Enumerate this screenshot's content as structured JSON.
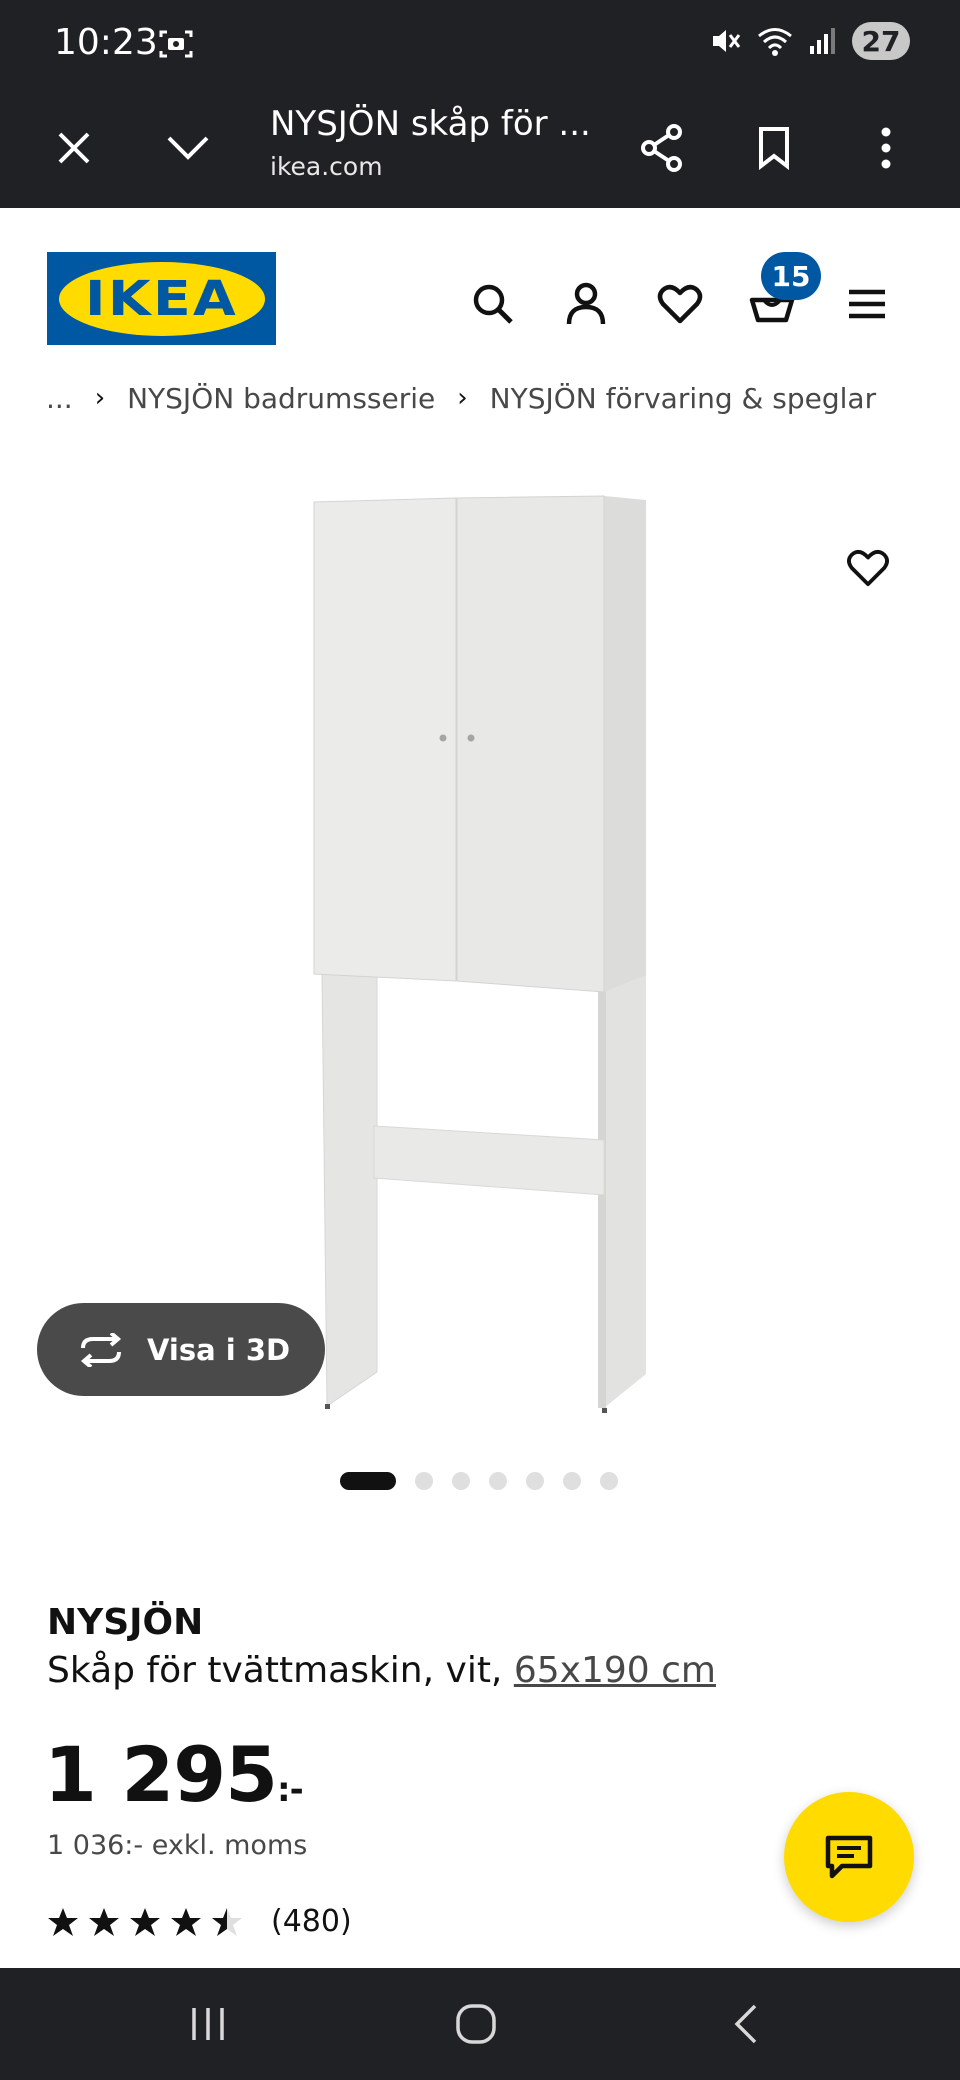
{
  "status_bar": {
    "time": "10:23",
    "battery": "27"
  },
  "browser": {
    "page_title": "NYSJÖN skåp för ...",
    "url": "ikea.com"
  },
  "header": {
    "logo_text": "IKEA",
    "cart_count": "15"
  },
  "breadcrumb": {
    "items": [
      "...",
      "NYSJÖN badrumsserie",
      "NYSJÖN förvaring & speglar"
    ]
  },
  "product": {
    "view_3d_label": "Visa i 3D",
    "name": "NYSJÖN",
    "description": "Skåp för tvättmaskin, vit, ",
    "size": "65x190 cm",
    "price": "1 295",
    "price_suffix": ":-",
    "price_excl_vat": "1 036:- exkl. moms",
    "rating": 4.5,
    "review_count": "(480)",
    "image_count": 7,
    "active_image": 1
  },
  "colors": {
    "ikea_blue": "#0058a3",
    "ikea_yellow": "#ffdb00",
    "system_bar": "#202124"
  }
}
